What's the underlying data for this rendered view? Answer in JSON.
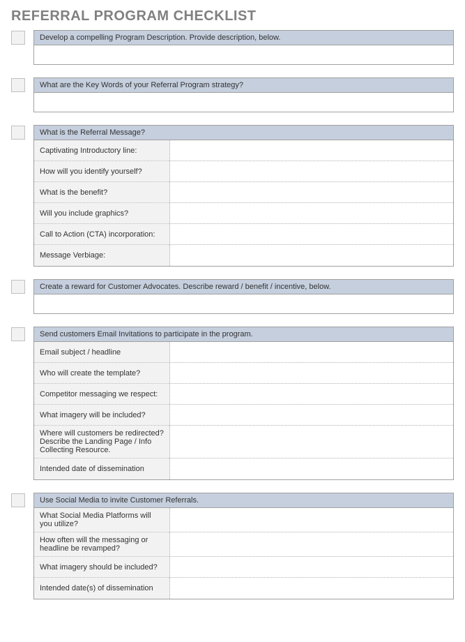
{
  "title": "REFERRAL PROGRAM CHECKLIST",
  "sections": [
    {
      "header": "Develop a compelling Program Description.  Provide description, below.",
      "textarea": true,
      "rows": []
    },
    {
      "header": "What are the Key Words of your Referral Program strategy?",
      "textarea": true,
      "rows": []
    },
    {
      "header": "What is the Referral Message?",
      "textarea": false,
      "rows": [
        "Captivating Introductory line:",
        "How will you identify yourself?",
        "What is the benefit?",
        "Will you include graphics?",
        "Call to Action (CTA) incorporation:",
        "Message Verbiage:"
      ]
    },
    {
      "header": "Create a reward for Customer Advocates.  Describe reward / benefit / incentive, below.",
      "textarea": true,
      "rows": []
    },
    {
      "header": "Send customers Email Invitations to participate in the program.",
      "textarea": false,
      "rows": [
        "Email subject / headline",
        "Who will create the template?",
        "Competitor messaging we respect:",
        "What imagery will be included?",
        "Where will customers be redirected? Describe the Landing Page / Info Collecting Resource.",
        "Intended date of dissemination"
      ]
    },
    {
      "header": "Use Social Media to invite Customer Referrals.",
      "textarea": false,
      "rows": [
        "What Social Media Platforms will you utilize?",
        "How often will the messaging or headline be revamped?",
        "What imagery should be included?",
        "Intended date(s) of dissemination"
      ]
    }
  ]
}
